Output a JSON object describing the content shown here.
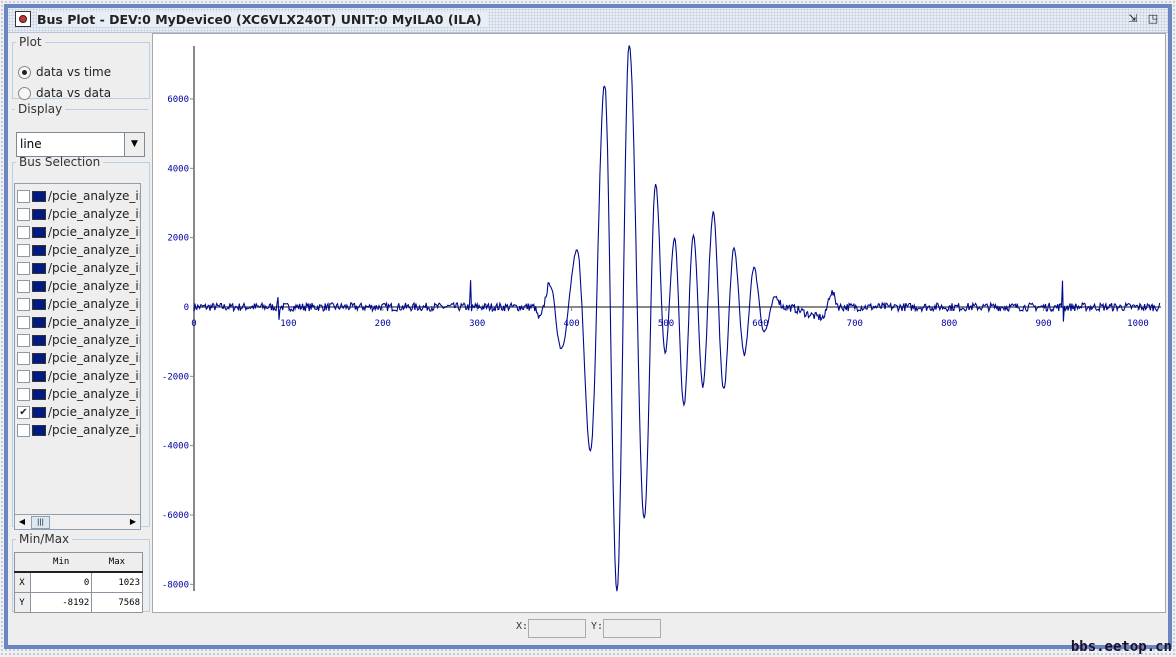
{
  "window": {
    "title": "Bus Plot - DEV:0 MyDevice0 (XC6VLX240T) UNIT:0 MyILA0 (ILA)",
    "buttons": [
      "restore",
      "maximize"
    ]
  },
  "plot_group": {
    "label": "Plot",
    "options": [
      {
        "label": "data vs time",
        "selected": true
      },
      {
        "label": "data vs data",
        "selected": false
      }
    ]
  },
  "display_group": {
    "label": "Display",
    "value": "line"
  },
  "bus_selection": {
    "label": "Bus Selection",
    "color": "#001a80",
    "items": [
      {
        "label": "/pcie_analyze_in",
        "checked": false
      },
      {
        "label": "/pcie_analyze_in",
        "checked": false
      },
      {
        "label": "/pcie_analyze_in",
        "checked": false
      },
      {
        "label": "/pcie_analyze_in",
        "checked": false
      },
      {
        "label": "/pcie_analyze_in",
        "checked": false
      },
      {
        "label": "/pcie_analyze_in",
        "checked": false
      },
      {
        "label": "/pcie_analyze_in",
        "checked": false
      },
      {
        "label": "/pcie_analyze_in",
        "checked": false
      },
      {
        "label": "/pcie_analyze_in",
        "checked": false
      },
      {
        "label": "/pcie_analyze_in",
        "checked": false
      },
      {
        "label": "/pcie_analyze_in",
        "checked": false
      },
      {
        "label": "/pcie_analyze_in",
        "checked": false
      },
      {
        "label": "/pcie_analyze_in",
        "checked": true
      },
      {
        "label": "/pcie_analyze_in",
        "checked": false
      }
    ]
  },
  "minmax": {
    "label": "Min/Max",
    "headers": [
      "",
      "Min",
      "Max"
    ],
    "rows": [
      [
        "X",
        "0",
        "1023"
      ],
      [
        "Y",
        "-8192",
        "7568"
      ]
    ]
  },
  "coords": {
    "x_label": "X:",
    "y_label": "Y:",
    "x_value": "",
    "y_value": ""
  },
  "watermark": "bbs.eetop.cn",
  "chart_data": {
    "type": "line",
    "title": "",
    "xlabel": "",
    "ylabel": "",
    "xlim": [
      0,
      1023
    ],
    "ylim": [
      -8192,
      7568
    ],
    "xticks": [
      0,
      100,
      200,
      300,
      400,
      500,
      600,
      700,
      800,
      900,
      1000
    ],
    "yticks": [
      6000,
      4000,
      2000,
      0,
      -2000,
      -4000,
      -6000,
      -8000
    ],
    "series": [
      {
        "name": "/pcie_analyze_in",
        "color": "#000a8c",
        "key_points": [
          [
            0,
            0
          ],
          [
            88,
            0
          ],
          [
            89,
            350
          ],
          [
            90,
            -400
          ],
          [
            91,
            0
          ],
          [
            292,
            0
          ],
          [
            293,
            700
          ],
          [
            294,
            -150
          ],
          [
            295,
            0
          ],
          [
            360,
            0
          ],
          [
            366,
            -337
          ],
          [
            377,
            663
          ],
          [
            389,
            -1180
          ],
          [
            406,
            1611
          ],
          [
            420,
            -4128
          ],
          [
            435,
            6423
          ],
          [
            448,
            -8192
          ],
          [
            461,
            7568
          ],
          [
            477,
            -6128
          ],
          [
            489,
            3559
          ],
          [
            499,
            -1337
          ],
          [
            509,
            1980
          ],
          [
            519,
            -2811
          ],
          [
            529,
            2106
          ],
          [
            539,
            -2285
          ],
          [
            550,
            2717
          ],
          [
            561,
            -2390
          ],
          [
            572,
            1664
          ],
          [
            583,
            -1390
          ],
          [
            593,
            1137
          ],
          [
            604,
            -705
          ],
          [
            616,
            295
          ],
          [
            625,
            0
          ],
          [
            667,
            -300
          ],
          [
            675,
            420
          ],
          [
            684,
            0
          ],
          [
            919,
            0
          ],
          [
            920,
            800
          ],
          [
            921,
            -350
          ],
          [
            922,
            0
          ],
          [
            1023,
            0
          ]
        ],
        "noise_amplitude": 150
      }
    ]
  }
}
